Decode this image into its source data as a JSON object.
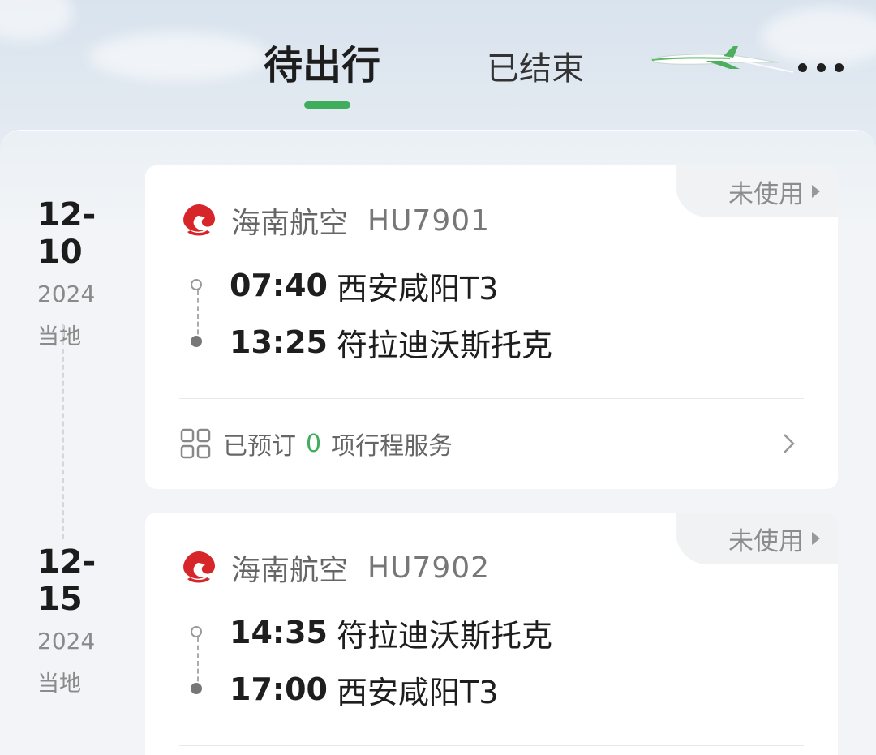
{
  "tabs": {
    "upcoming": "待出行",
    "ended": "已结束"
  },
  "accent_color": "#3fae5c",
  "icons": {
    "more": "more-dots-icon",
    "plane": "plane-illustration",
    "logo": "hainan-airlines-logo",
    "services": "grid-icon",
    "chevron": "chevron-right-icon"
  },
  "trips": [
    {
      "date": "12-10",
      "year": "2024",
      "local": "当地",
      "status": "未使用",
      "airline": "海南航空",
      "flight_no": "HU7901",
      "depart_time": "07:40",
      "depart_place": "西安咸阳T3",
      "arrive_time": "13:25",
      "arrive_place": "符拉迪沃斯托克",
      "service_prefix": "已预订",
      "service_count": "0",
      "service_suffix": "项行程服务"
    },
    {
      "date": "12-15",
      "year": "2024",
      "local": "当地",
      "status": "未使用",
      "airline": "海南航空",
      "flight_no": "HU7902",
      "depart_time": "14:35",
      "depart_place": "符拉迪沃斯托克",
      "arrive_time": "17:00",
      "arrive_place": "西安咸阳T3"
    }
  ]
}
